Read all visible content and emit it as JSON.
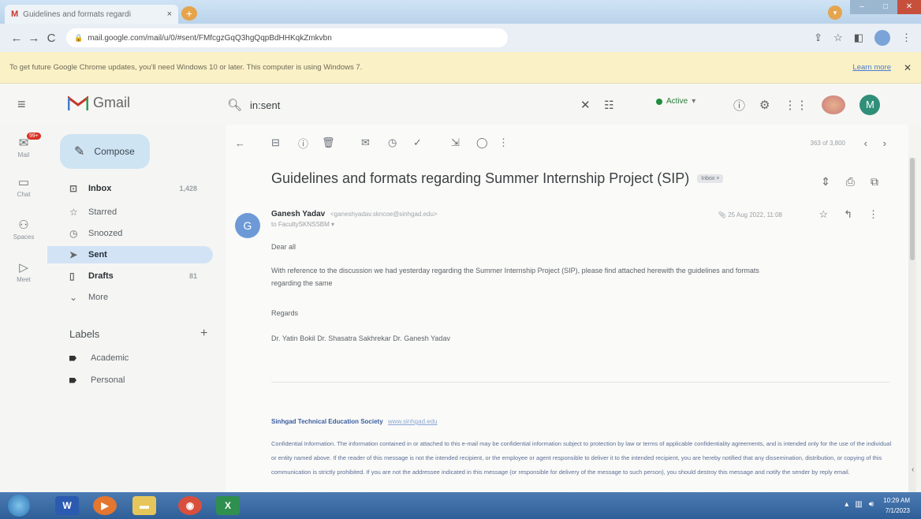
{
  "browser": {
    "tab_title": "Guidelines and formats regardi",
    "tab_close": "×",
    "new_tab": "+",
    "url": "mail.google.com/mail/u/0/#sent/FMfcgzGqQ3hgQqpBdHHKqkZmkvbn",
    "infobar_text": "To get future Google Chrome updates, you'll need Windows 10 or later. This computer is using Windows 7.",
    "infobar_learn_more": "Learn more",
    "infobar_close": "✕"
  },
  "gmail": {
    "product_name": "Gmail",
    "search_value": "in:sent",
    "status_label": "Active",
    "avatar_letter": "M"
  },
  "rail": {
    "mail_label": "Mail",
    "mail_badge": "99+",
    "chat_label": "Chat",
    "spaces_label": "Spaces",
    "meet_label": "Meet"
  },
  "sidebar": {
    "compose_label": "Compose",
    "items": [
      {
        "label": "Inbox",
        "count": "1,428"
      },
      {
        "label": "Starred",
        "count": ""
      },
      {
        "label": "Snoozed",
        "count": ""
      },
      {
        "label": "Sent",
        "count": ""
      },
      {
        "label": "Drafts",
        "count": "81"
      },
      {
        "label": "More",
        "count": ""
      }
    ],
    "labels_heading": "Labels",
    "labels_add": "+",
    "labels": [
      "Academic",
      "Personal"
    ]
  },
  "conversation": {
    "pager": "363 of 3,800",
    "subject": "Guidelines and formats regarding Summer Internship Project (SIP)",
    "inbox_chip": "Inbox ×",
    "sender_initial": "G",
    "sender_name": "Ganesh Yadav",
    "sender_email": "<ganeshyadav.skncoe@sinhgad.edu>",
    "to_line": "to FacultySKNSSBM ▾",
    "date": "25 Aug 2022, 11:08",
    "greeting": "Dear all",
    "body_line1": "With reference to the discussion we had yesterday regarding the Summer Internship Project (SIP), please find attached herewith the guidelines and formats",
    "body_line2": "regarding the same",
    "regards": "Regards",
    "signature": "Dr. Yatin Bokil   Dr. Shasatra Sakhrekar   Dr. Ganesh Yadav",
    "footer_org": "Sinhgad Technical Education Society",
    "footer_link": "www.sinhgad.edu",
    "disclaimer": "Confidential Information. The information contained in or attached to this e-mail may be confidential information subject to protection by law or terms of applicable confidentiality agreements, and is intended only for the use of the individual or entity named above. If the reader of this message is not the intended recipient, or the employee or agent responsible to deliver it to the intended recipient, you are hereby notified that any dissemination, distribution, or copying of this communication is strictly prohibited. If you are not the addressee indicated in this message (or responsible for delivery of the message to such person), you should destroy this message and notify the sender by reply email."
  },
  "taskbar": {
    "word_label": "W",
    "excel_label": "X",
    "time": "10:29 AM",
    "date": "7/1/2023"
  }
}
